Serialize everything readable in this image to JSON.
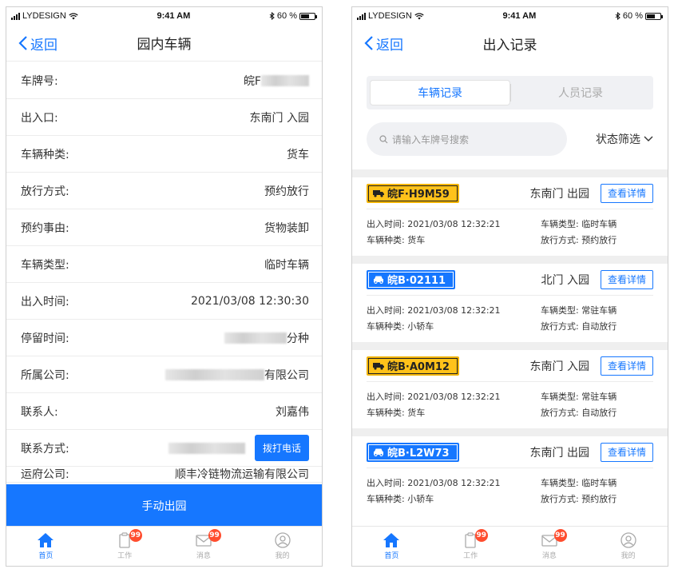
{
  "status": {
    "carrier": "LYDESIGN",
    "time": "9:41 AM",
    "battery": "60 %"
  },
  "left": {
    "back_label": "返回",
    "title": "园内车辆",
    "rows": [
      {
        "label": "车牌号:",
        "value": "皖F"
      },
      {
        "label": "出入口:",
        "value": "东南门 入园"
      },
      {
        "label": "车辆种类:",
        "value": "货车"
      },
      {
        "label": "放行方式:",
        "value": "预约放行"
      },
      {
        "label": "预约事由:",
        "value": "货物装卸"
      },
      {
        "label": "车辆类型:",
        "value": "临时车辆"
      },
      {
        "label": "出入时间:",
        "value": "2021/03/08 12:30:30"
      },
      {
        "label": "停留时间:",
        "value": "分种"
      },
      {
        "label": "所属公司:",
        "value": "有限公司"
      },
      {
        "label": "联系人:",
        "value": "刘嘉伟"
      },
      {
        "label": "联系方式:",
        "value": ""
      },
      {
        "label": "运府公司:",
        "value": "顺丰冷链物流运输有限公司"
      }
    ],
    "call_label": "拨打电话",
    "manual_exit_label": "手动出园"
  },
  "tabbar": {
    "items": [
      {
        "label": "首页",
        "icon": "home-icon"
      },
      {
        "label": "工作",
        "icon": "clipboard-icon",
        "badge": "99"
      },
      {
        "label": "消息",
        "icon": "mail-icon",
        "badge": "99"
      },
      {
        "label": "我的",
        "icon": "user-icon"
      }
    ]
  },
  "right": {
    "back_label": "返回",
    "title": "出入记录",
    "tabs": [
      "车辆记录",
      "人员记录"
    ],
    "search_placeholder": "请输入车牌号搜索",
    "filter_label": "状态筛选",
    "detail_btn": "查看详情",
    "field_labels": {
      "time": "出入时间:",
      "type": "车辆类型:",
      "kind": "车辆种类:",
      "release": "放行方式:"
    },
    "records": [
      {
        "plate": "皖F·H9M59",
        "plate_color": "yellow",
        "gate": "东南门 出园",
        "time": "2021/03/08 12:32:21",
        "type": "临时车辆",
        "kind": "货车",
        "release": "预约放行"
      },
      {
        "plate": "皖B·02111",
        "plate_color": "blue",
        "gate": "北门 入园",
        "time": "2021/03/08 12:32:21",
        "type": "常驻车辆",
        "kind": "小轿车",
        "release": "自动放行"
      },
      {
        "plate": "皖B·A0M12",
        "plate_color": "yellow",
        "gate": "东南门 入园",
        "time": "2021/03/08 12:32:21",
        "type": "常驻车辆",
        "kind": "货车",
        "release": "自动放行"
      },
      {
        "plate": "皖B·L2W73",
        "plate_color": "blue",
        "gate": "东南门 出园",
        "time": "2021/03/08 12:32:21",
        "type": "临时车辆",
        "kind": "小轿车",
        "release": "预约放行"
      }
    ]
  },
  "colors": {
    "accent": "#1677ff",
    "badge": "#ff4d2e",
    "plate_yellow": "#ffc21a"
  }
}
